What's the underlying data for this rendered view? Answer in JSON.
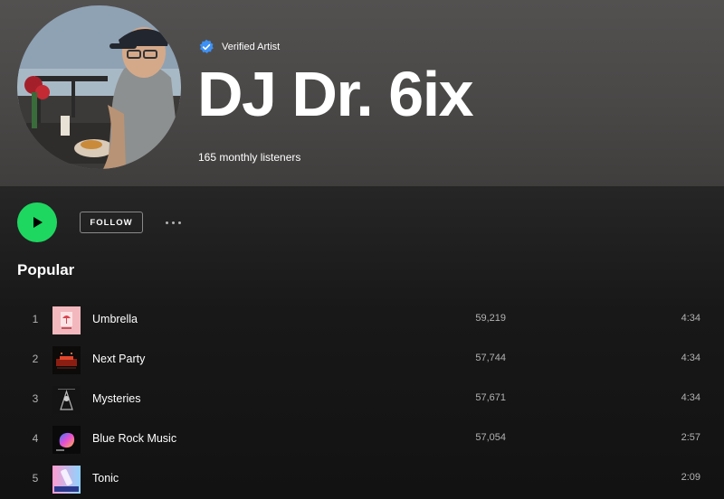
{
  "artist": {
    "verified_label": "Verified Artist",
    "name": "DJ Dr. 6ix",
    "monthly_listeners": "165 monthly listeners"
  },
  "actions": {
    "follow_label": "FOLLOW"
  },
  "popular": {
    "title": "Popular",
    "tracks": [
      {
        "number": "1",
        "title": "Umbrella",
        "plays": "59,219",
        "duration": "4:34"
      },
      {
        "number": "2",
        "title": "Next Party",
        "plays": "57,744",
        "duration": "4:34"
      },
      {
        "number": "3",
        "title": "Mysteries",
        "plays": "57,671",
        "duration": "4:34"
      },
      {
        "number": "4",
        "title": "Blue Rock Music",
        "plays": "57,054",
        "duration": "2:57"
      },
      {
        "number": "5",
        "title": "Tonic",
        "plays": "",
        "duration": "2:09"
      }
    ]
  },
  "colors": {
    "accent": "#1ed760",
    "verified": "#3d91f4",
    "background": "#121212",
    "header": "#4a4847"
  },
  "icons": {
    "verified": "verified-badge-icon",
    "play": "play-icon",
    "more": "more-options-icon"
  }
}
